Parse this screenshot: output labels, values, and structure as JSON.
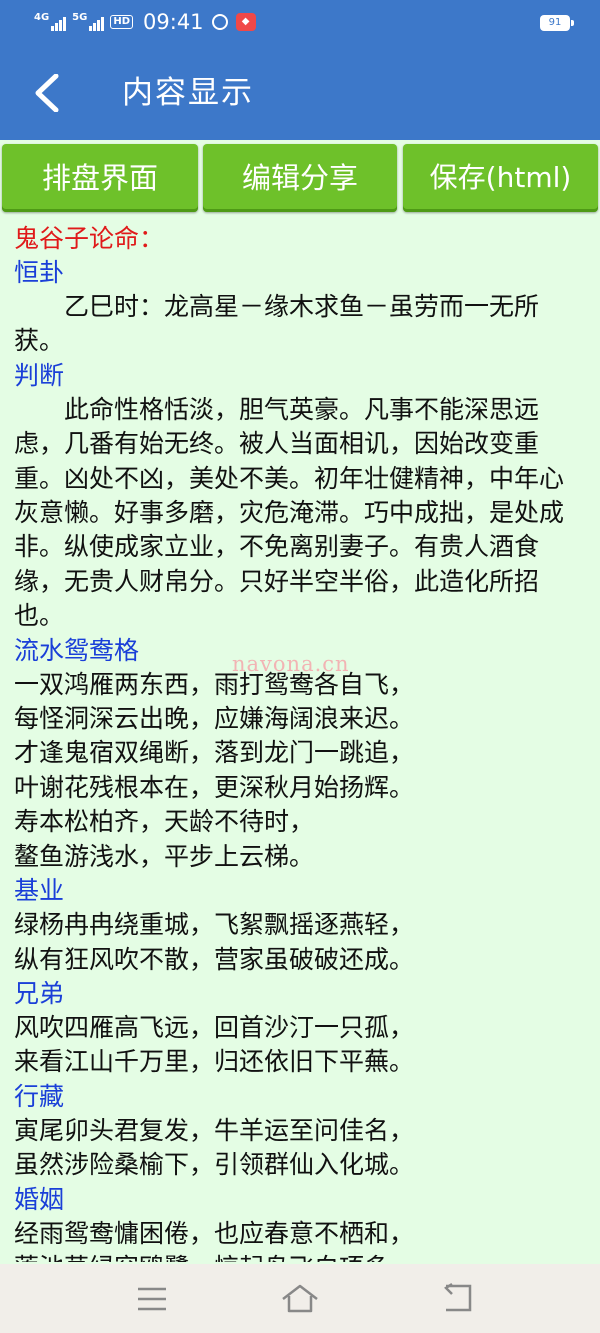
{
  "status": {
    "net1": "4G",
    "net2": "5G",
    "hd": "HD",
    "time": "09:41",
    "app_badge": "",
    "battery": "91"
  },
  "appbar": {
    "title": "内容显示",
    "back_icon": "chevron-left-icon"
  },
  "tabs": [
    {
      "label": "排盘界面"
    },
    {
      "label": "编辑分享"
    },
    {
      "label": "保存(html)"
    }
  ],
  "content": {
    "title": "鬼谷子论命：",
    "sections": [
      {
        "heading": "恒卦",
        "paragraph": "乙巳时：龙高星－缘木求鱼－虽劳而一无所获。"
      },
      {
        "heading": "判断",
        "paragraph": "此命性格恬淡，胆气英豪。凡事不能深思远虑，几番有始无终。被人当面相讥，因始改变重重。凶处不凶，美处不美。初年壮健精神，中年心灰意懒。好事多磨，灾危淹滞。巧中成拙，是处成非。纵使成家立业，不免离别妻子。有贵人酒食缘，无贵人财帛分。只好半空半俗，此造化所招也。"
      },
      {
        "heading": "流水鸳鸯格",
        "lines": [
          "一双鸿雁两东西，雨打鸳鸯各自飞，",
          "每怪洞深云出晚，应嫌海阔浪来迟。",
          "才逢鬼宿双绳断，落到龙门一跳追，",
          "叶谢花残根本在，更深秋月始扬辉。",
          "寿本松柏齐，天龄不待时，",
          "鳌鱼游浅水，平步上云梯。"
        ]
      },
      {
        "heading": "基业",
        "lines": [
          "绿杨冉冉绕重城，飞絮飘摇逐燕轻，",
          "纵有狂风吹不散，营家虽破破还成。"
        ]
      },
      {
        "heading": "兄弟",
        "lines": [
          "风吹四雁高飞远，回首沙汀一只孤，",
          "来看江山千万里，归还依旧下平蕪。"
        ]
      },
      {
        "heading": "行藏",
        "lines": [
          "寅尾卯头君复发，牛羊运至问佳名，",
          "虽然涉险桑榆下，引领群仙入化城。"
        ]
      },
      {
        "heading": "婚姻",
        "lines": [
          "经雨鸳鸯慵困倦，也应春意不栖和，",
          "莲池草绿容鸥鹭，惊起鸟飞白项多。"
        ]
      }
    ],
    "watermark": "navona.cn"
  },
  "navbar": {
    "menu_icon": "menu-icon",
    "home_icon": "home-icon",
    "back_icon": "back-icon"
  },
  "colors": {
    "bar": "#3d78c9",
    "button": "#6ec12a",
    "background": "#e4fde4",
    "red_heading": "#e01a1a",
    "blue_heading": "#1a3fd8"
  }
}
